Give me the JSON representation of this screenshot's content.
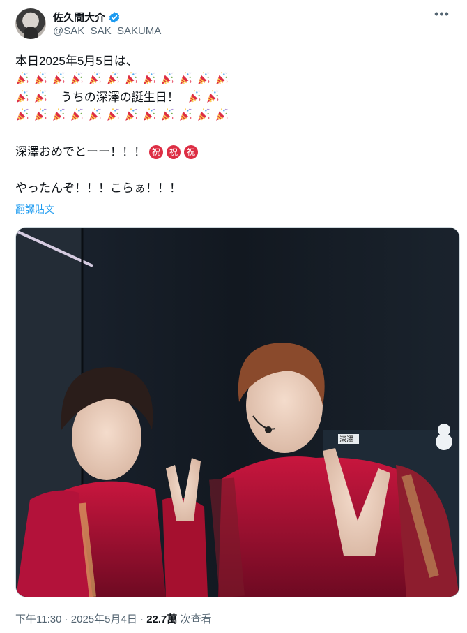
{
  "author": {
    "display_name": "佐久間大介",
    "handle": "@SAK_SAK_SAKUMA",
    "verified_icon": "verified-badge-icon",
    "more_icon": "more-options-icon"
  },
  "tweet": {
    "line1": "本日2025年5月5日は、",
    "line3_text": "うちの深澤の誕生日！",
    "line5_text": "深澤おめでとーー！！！",
    "line5_marks": [
      "祝",
      "祝",
      "祝"
    ],
    "line7_text": "やったんぞ！！！こらぁ！！！",
    "emoji": "party-popper-icon",
    "emoji_color": "#dd2e44"
  },
  "translate_label": "翻譯貼文",
  "media": {
    "sign_text": "深澤"
  },
  "footer": {
    "time": "下午11:30",
    "separator1": "·",
    "date": "2025年5月4日",
    "separator2": "·",
    "views": "22.7萬",
    "views_label": "次查看"
  },
  "colors": {
    "link": "#1d9bf0",
    "secondary_text": "#536471",
    "verified": "#1d9bf0"
  }
}
